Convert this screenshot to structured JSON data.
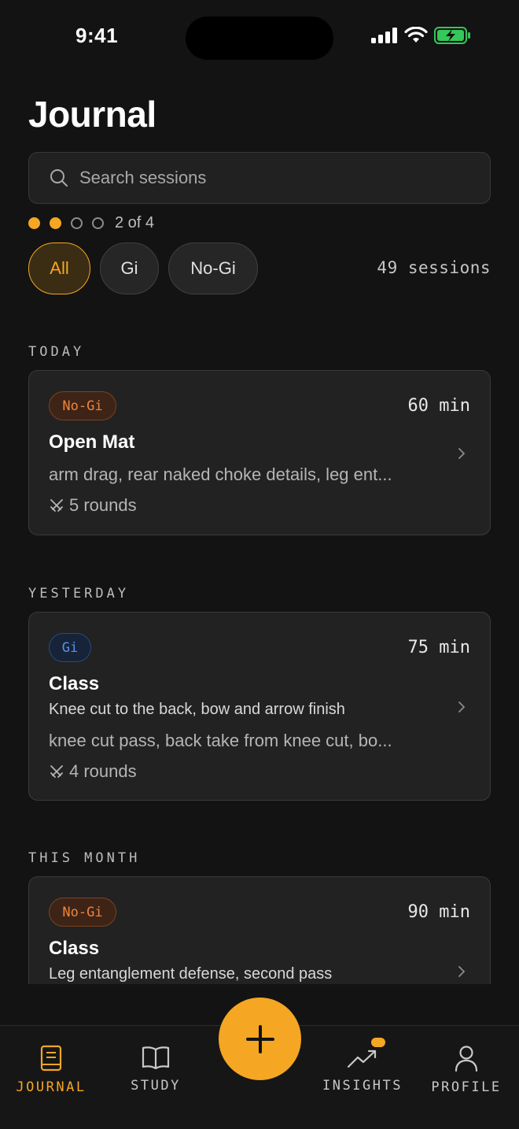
{
  "status": {
    "time": "9:41"
  },
  "page": {
    "title": "Journal"
  },
  "search": {
    "placeholder": "Search sessions"
  },
  "pager": {
    "text": "2 of 4",
    "current": 2,
    "total": 4
  },
  "filters": [
    {
      "label": "All",
      "active": true
    },
    {
      "label": "Gi",
      "active": false
    },
    {
      "label": "No-Gi",
      "active": false
    }
  ],
  "session_count": "49 sessions",
  "sections": [
    {
      "label": "TODAY",
      "cards": [
        {
          "tag": "No-Gi",
          "duration": "60 min",
          "title": "Open Mat",
          "techniques": "arm drag, rear naked choke details, leg ent...",
          "rounds": "5 rounds"
        }
      ]
    },
    {
      "label": "YESTERDAY",
      "cards": [
        {
          "tag": "Gi",
          "duration": "75 min",
          "title": "Class",
          "description": "Knee cut to the back, bow and arrow finish",
          "techniques": "knee cut pass, back take from knee cut, bo...",
          "rounds": "4 rounds"
        }
      ]
    },
    {
      "label": "THIS MONTH",
      "cards": [
        {
          "tag": "No-Gi",
          "duration": "90 min",
          "title": "Class",
          "description": "Leg entanglement defense, second pass"
        }
      ]
    }
  ],
  "tabs": [
    {
      "label": "JOURNAL",
      "icon": "journal-icon",
      "active": true
    },
    {
      "label": "STUDY",
      "icon": "book-icon",
      "active": false
    },
    {
      "label": "INSIGHTS",
      "icon": "trend-icon",
      "active": false
    },
    {
      "label": "PROFILE",
      "icon": "user-icon",
      "active": false
    }
  ],
  "colors": {
    "accent": "#F5A623",
    "nogi": "#F0843C",
    "gi": "#5B92E8",
    "background": "#131313"
  }
}
